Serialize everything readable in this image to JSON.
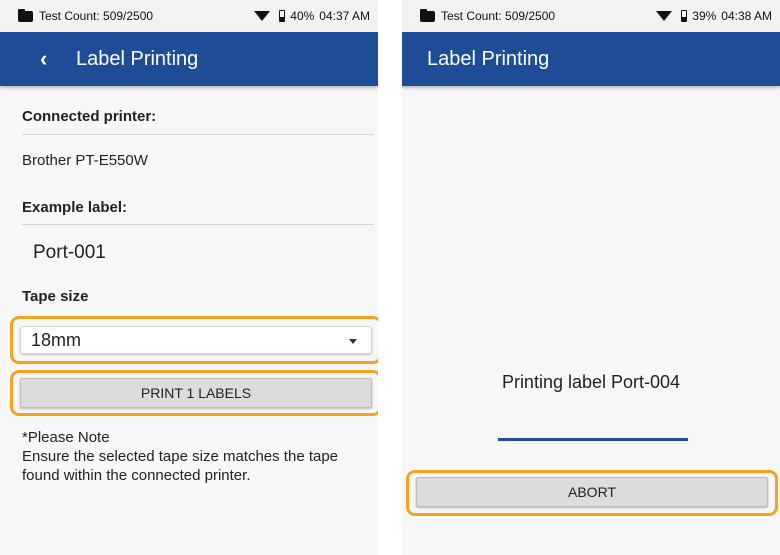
{
  "left": {
    "status": {
      "count": "Test Count: 509/2500",
      "battery": "40%",
      "time": "04:37 AM"
    },
    "app_bar": {
      "title": "Label Printing"
    },
    "connected_printer": {
      "label": "Connected printer:",
      "value": "Brother PT-E550W"
    },
    "example_label": {
      "label": "Example label:",
      "value": "Port-001"
    },
    "tape_size": {
      "label": "Tape size",
      "selected": "18mm"
    },
    "print_button": "PRINT 1 LABELS",
    "note": {
      "title": "*Please Note",
      "body": "Ensure the selected tape size matches the tape found within the connected printer."
    }
  },
  "right": {
    "status": {
      "count": "Test Count: 509/2500",
      "battery": "39%",
      "time": "04:38 AM"
    },
    "app_bar": {
      "title": "Label Printing"
    },
    "message": "Printing label Port-004",
    "abort_button": "ABORT"
  },
  "colors": {
    "app_bar": "#1e4c97",
    "highlight": "#f4a21f",
    "button": "#dcdcdc"
  }
}
